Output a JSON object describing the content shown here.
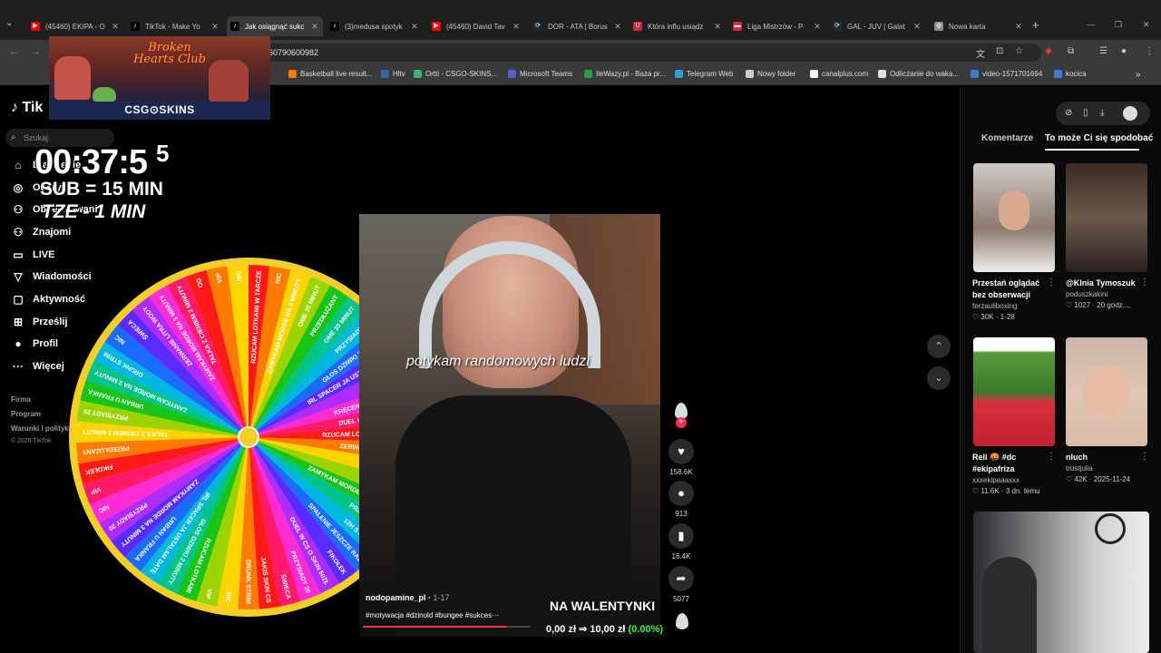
{
  "browser": {
    "tabs": [
      {
        "title": "(45460) EKIPA - O",
        "color": "#ff0000",
        "glyph": "▶"
      },
      {
        "title": "TikTok - Make Yo",
        "color": "#000000",
        "glyph": "♪"
      },
      {
        "title": "Jak osiągnąć sukc",
        "color": "#000000",
        "glyph": "♪"
      },
      {
        "title": "(3)medusa spotyk",
        "color": "#000000",
        "glyph": "♪"
      },
      {
        "title": "(45460) David Tav",
        "color": "#ff0000",
        "glyph": "▶"
      },
      {
        "title": "DOR - ATA | Borus",
        "color": "#1b2a3a",
        "glyph": "⟳"
      },
      {
        "title": "Która influ usiądz",
        "color": "#d12b3a",
        "glyph": "U"
      },
      {
        "title": "Liga Mistrzów - P",
        "color": "#d12b3a",
        "glyph": "▬"
      },
      {
        "title": "GAL - JUV | Galat",
        "color": "#1b2a3a",
        "glyph": "⟳"
      },
      {
        "title": "Nowa karta",
        "color": "#8a8a8a",
        "glyph": "◍"
      }
    ],
    "url": "60790600982",
    "bookmarks": [
      {
        "label": "Basketball live result...",
        "color": "#ff7a00"
      },
      {
        "label": "Hltv",
        "color": "#2d6ba6"
      },
      {
        "label": "Ortti - CSGO-SKINS...",
        "color": "#3cb371"
      },
      {
        "label": "Microsoft Teams",
        "color": "#5b5fc7"
      },
      {
        "label": "IleWazy.pl - Baza pr...",
        "color": "#2a9d4a"
      },
      {
        "label": "Telegram Web",
        "color": "#2aa1da"
      },
      {
        "label": "Nowy folder",
        "color": "#cccccc"
      },
      {
        "label": "canalplus.com",
        "color": "#ffffff"
      },
      {
        "label": "Odliczanie do waka...",
        "color": "#e0e0e0"
      },
      {
        "label": "video-1571701694",
        "color": "#3a7bd5"
      },
      {
        "label": "kocica",
        "color": "#3a7bd5"
      }
    ]
  },
  "banner": {
    "club": "Broken Hearts Club",
    "brand": "CSG⊙SKINS"
  },
  "tiktok": {
    "logo": "Tik",
    "search_placeholder": "Szukaj",
    "nav": [
      {
        "label": "Dla Ciebie",
        "icon": "⌂"
      },
      {
        "label": "Odkryj",
        "icon": "◎"
      },
      {
        "label": "Obserwowani",
        "icon": "⚇"
      },
      {
        "label": "Znajomi",
        "icon": "⚇"
      },
      {
        "label": "LIVE",
        "icon": "▭"
      },
      {
        "label": "Wiadomości",
        "icon": "▽"
      },
      {
        "label": "Aktywność",
        "icon": "▢"
      },
      {
        "label": "Prześlij",
        "icon": "⊞"
      },
      {
        "label": "Profil",
        "icon": "●"
      },
      {
        "label": "Więcej",
        "icon": "···"
      }
    ],
    "footer": [
      "Firma",
      "Program",
      "Warunki i polityka"
    ],
    "copyright": "© 2026 TikTok"
  },
  "stream": {
    "timer": "00:37:5",
    "timer_sup": "5",
    "rule_sub": "SUB = 15 MIN",
    "rule_tz": "TZE - 1 MIN"
  },
  "wheel": {
    "segments": [
      "RZUCAM LOTKAMI W TARCZE",
      "NIC",
      "ZAMYKAM MORDE NA 3 MINUTY",
      "OME 30 MINUT",
      "PRZEDŁUŻANY",
      "OME 30 MINUT",
      "PRZYSIADY 20",
      "GŁOS DZIWKI 2 MINUTY",
      "IRL SPACER JA USTALAM DATĘ",
      "ŚWIECA",
      "KRĘCENIE JESZCZE RAZ",
      "DUEL W CS O SKIN 50ZŁ",
      "RZUCAM LOTKAMI W TARCZE",
      "ZERWANIE LITRA WODY",
      "NIC",
      "OG",
      "ZAMYKAM MORDE NA 3 MINUTY",
      "PRZYSIADY 20",
      "12H STREAM",
      "SPALENIE JESZCZE RAZ",
      "FIKOŁEK",
      "DUEL W CS O SKIN 50ZŁ",
      "PRZYSIADY 20",
      "ŚWIECA",
      "JAKIŚ SKIN CS",
      "DRUNK STRIM",
      "NIC",
      "VIP",
      "RZUCAM LOTKAMI",
      "GŁOS DZIWKI 2 MINUTY",
      "IRL SPACER JA USTALAM DATĘ",
      "URBAN U FRANKA",
      "ZAMYKAM MORDE NA 3 MINUTY",
      "PRZYSIADY 20",
      "NIC",
      "VIP",
      "FIKOŁEK",
      "PRZEDŁUŻANY",
      "TALKA Z CIENIEM 2 MINUTY",
      "PRZYSIADY 20",
      "URBAN U FRANKA",
      "ZAMYKAM MORDE NA 3 MINUTY",
      "DRUNK STRIM",
      "NIC",
      "ŚWIECA",
      "ZERWANIE LITRA WODY",
      "ZAMYKAM MORDE NA 3 MINUTY",
      "TALKA Z CIENIEM 2 MINUTY",
      "OG",
      "VIP",
      "NIC"
    ],
    "colors": [
      "#ff1a1a",
      "#ff7a00",
      "#ffd400",
      "#9bd400",
      "#19c419",
      "#00c48a",
      "#00b7e0",
      "#1a6bff",
      "#5a2bff",
      "#b02bff",
      "#ff2bd4",
      "#ff1a6b"
    ]
  },
  "video": {
    "caption": "potykam randomowych ludzi",
    "username": "nodopamine_pl",
    "date": "1-17",
    "hashtags": "#motywacja #dzinold #bungee #sukces···",
    "progress": 0.86,
    "overlay": "NA WALENTYNKI",
    "goal_text": "0,00 zł ⇒ 10,00 zł",
    "goal_pct": "(0.00%)",
    "likes": "158.6K",
    "comments": "913",
    "saves": "16.4K",
    "shares": "5077"
  },
  "right": {
    "tab_comments": "Komentarze",
    "tab_suggested": "To może Ci się spodobać",
    "cards": [
      {
        "title": "Przestań oglądać bez obserwacji",
        "author": "ferzauliboxing",
        "meta": "♡ 30K · 1-28"
      },
      {
        "title": "@Klnia Tymoszuk",
        "author": "poduszkakini",
        "meta": "♡ 1027 · 20 godz...."
      },
      {
        "title": "Reli 🤬 #dc #ekipafriza",
        "author": "xxxekipaaaxxx",
        "meta": "♡ 11.6K · 3 dn. temu"
      },
      {
        "title": "nluch",
        "author": "trustjulia",
        "meta": "♡ 42K · 2025-11-24"
      }
    ]
  }
}
